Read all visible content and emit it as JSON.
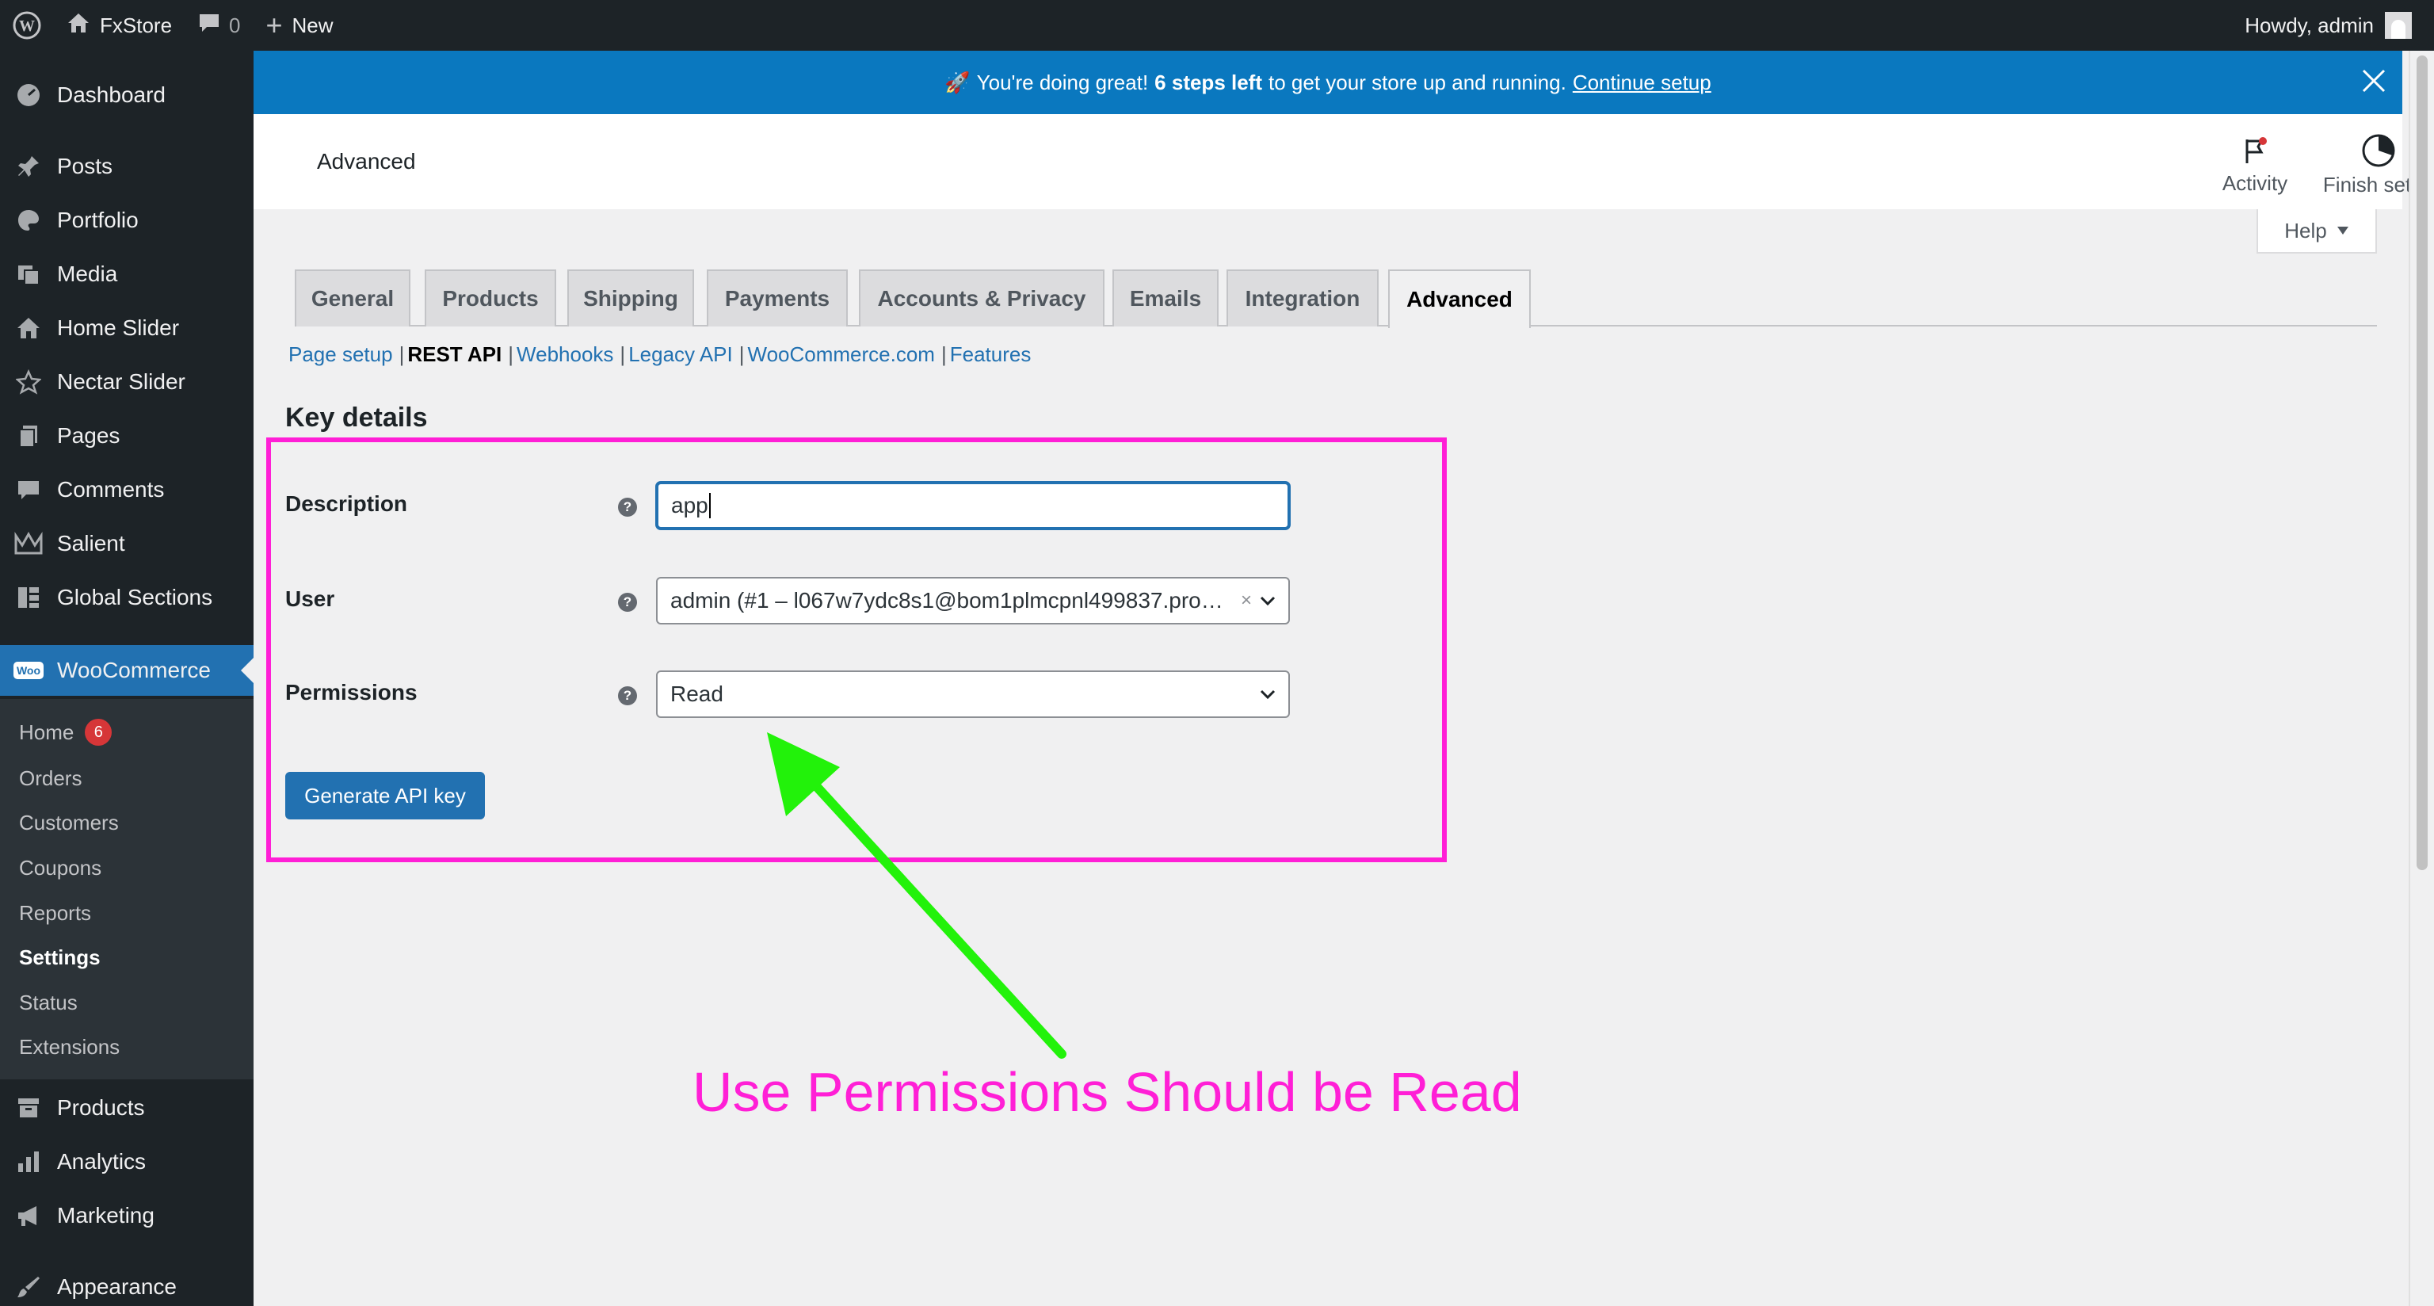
{
  "adminbar": {
    "site_name": "FxStore",
    "comments_count": "0",
    "new_label": "New",
    "howdy": "Howdy, admin"
  },
  "sidebar": {
    "items": [
      {
        "label": "Dashboard",
        "icon": "dashboard-icon"
      },
      {
        "label": "Posts",
        "icon": "pin-icon"
      },
      {
        "label": "Portfolio",
        "icon": "palette-icon"
      },
      {
        "label": "Media",
        "icon": "media-icon"
      },
      {
        "label": "Home Slider",
        "icon": "home-icon"
      },
      {
        "label": "Nectar Slider",
        "icon": "star-icon"
      },
      {
        "label": "Pages",
        "icon": "pages-icon"
      },
      {
        "label": "Comments",
        "icon": "comment-icon"
      },
      {
        "label": "Salient",
        "icon": "crown-icon"
      },
      {
        "label": "Global Sections",
        "icon": "grid-icon"
      },
      {
        "label": "WooCommerce",
        "icon": "woo-icon"
      },
      {
        "label": "Products",
        "icon": "archive-icon"
      },
      {
        "label": "Analytics",
        "icon": "bar-chart-icon"
      },
      {
        "label": "Marketing",
        "icon": "megaphone-icon"
      },
      {
        "label": "Appearance",
        "icon": "brush-icon"
      }
    ],
    "woo_logo": "Woo",
    "submenu": [
      {
        "label": "Home",
        "badge": "6"
      },
      {
        "label": "Orders"
      },
      {
        "label": "Customers"
      },
      {
        "label": "Coupons"
      },
      {
        "label": "Reports"
      },
      {
        "label": "Settings"
      },
      {
        "label": "Status"
      },
      {
        "label": "Extensions"
      }
    ]
  },
  "notice": {
    "emoji": "🚀",
    "text_before": "You're doing great!",
    "bold": "6 steps left",
    "text_after": "to get your store up and running.",
    "link": "Continue setup"
  },
  "header": {
    "title": "Advanced",
    "activity": "Activity",
    "finish_setup": "Finish setup",
    "help": "Help"
  },
  "tabs": [
    "General",
    "Products",
    "Shipping",
    "Payments",
    "Accounts & Privacy",
    "Emails",
    "Integration",
    "Advanced"
  ],
  "subnav": [
    "Page setup",
    "REST API",
    "Webhooks",
    "Legacy API",
    "WooCommerce.com",
    "Features"
  ],
  "form": {
    "heading": "Key details",
    "description_label": "Description",
    "description_value": "app",
    "user_label": "User",
    "user_value": "admin (#1 – l067w7ydc8s1@bom1plmcpnl499837.pro…",
    "permissions_label": "Permissions",
    "permissions_value": "Read",
    "generate_button": "Generate API key",
    "help_glyph": "?",
    "clear_glyph": "×"
  },
  "annotation": {
    "text": "Use Permissions Should be Read",
    "color": "#ff1fd6",
    "arrow_color": "#22f20a"
  },
  "colors": {
    "admin_bg": "#1d2327",
    "accent": "#2271b1",
    "notice_bg": "#0a78bf"
  }
}
